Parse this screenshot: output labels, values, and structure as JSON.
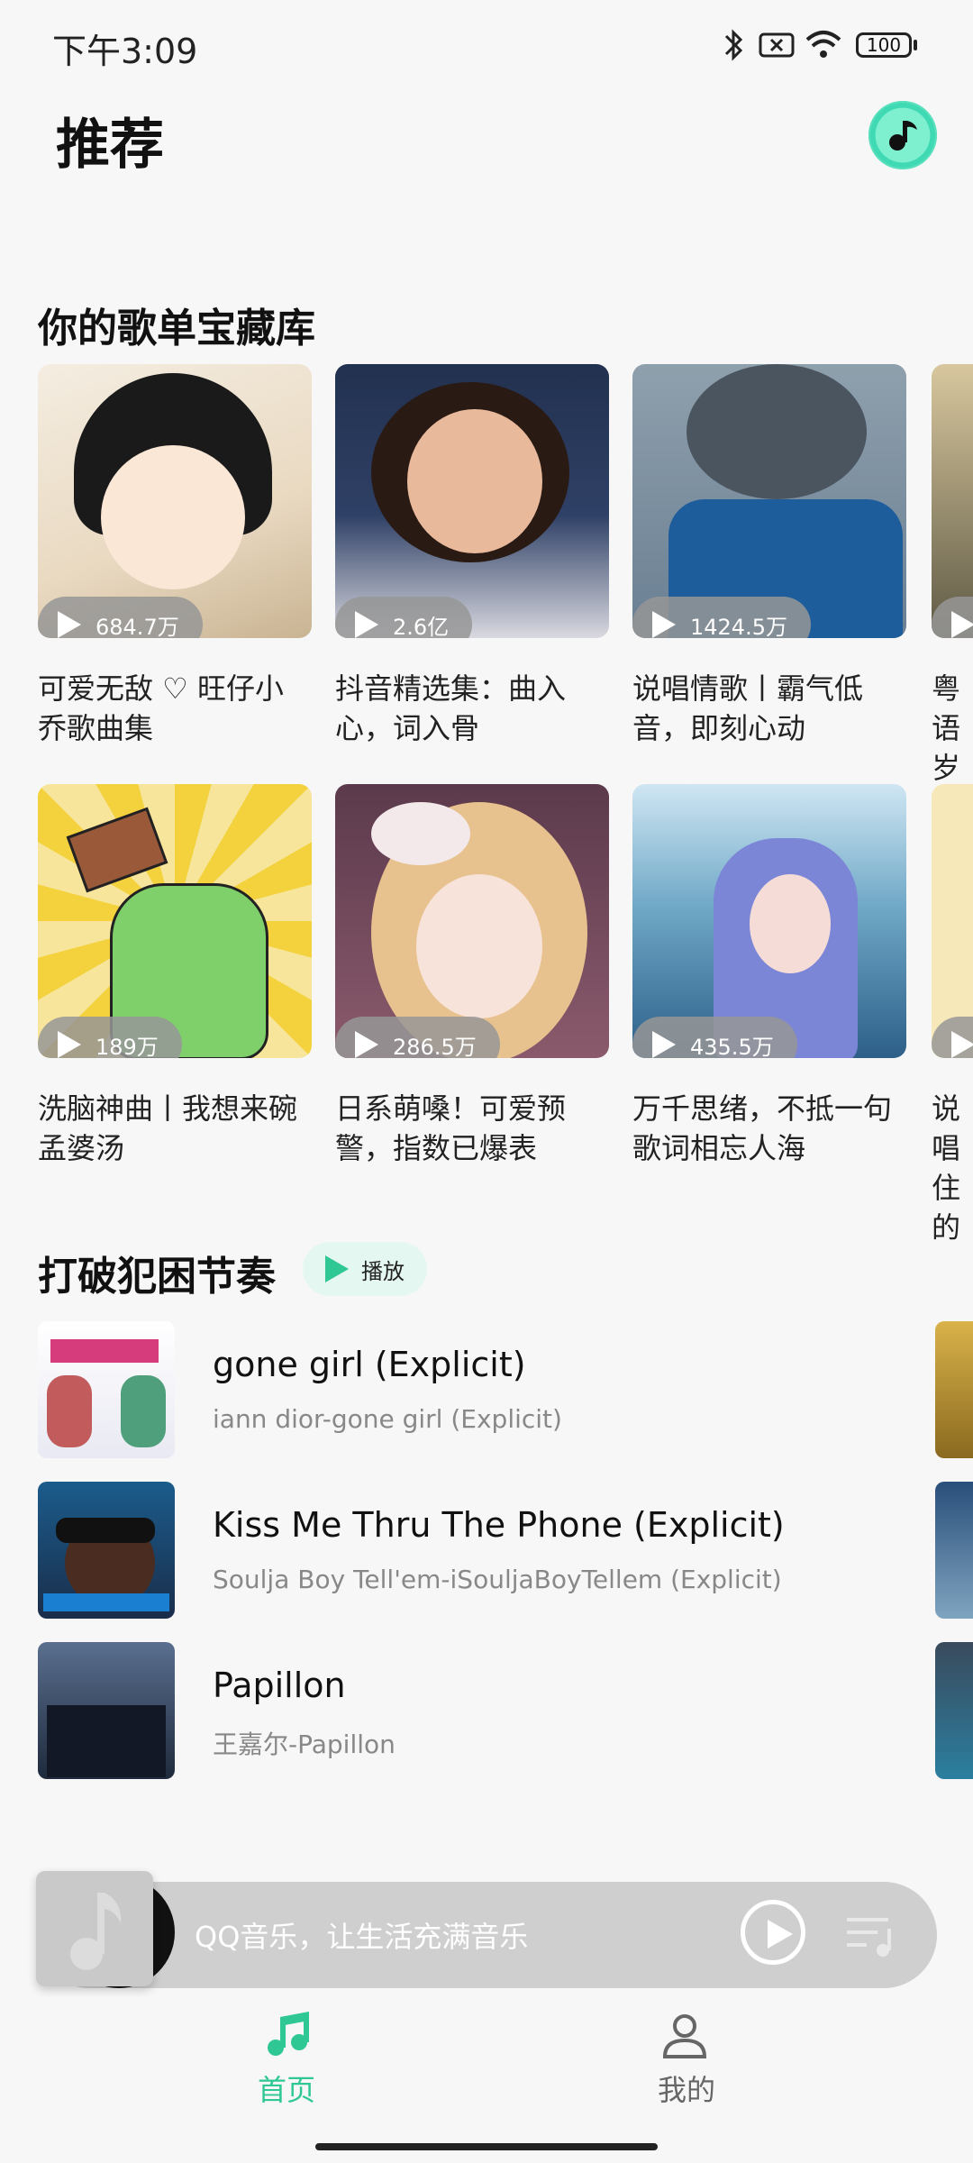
{
  "status_bar": {
    "time": "下午3:09",
    "battery": "100",
    "icons": [
      "bluetooth-icon",
      "sim-off-icon",
      "wifi-icon",
      "battery-icon"
    ]
  },
  "header": {
    "title": "推荐",
    "icon": "music-note-disc-icon"
  },
  "treasure_section": {
    "title": "你的歌单宝藏库",
    "playlists": [
      {
        "plays": "684.7万",
        "title": "可爱无敌 ♡ 旺仔小乔歌曲集"
      },
      {
        "plays": "2.6亿",
        "title": "抖音精选集：曲入心，词入骨"
      },
      {
        "plays": "1424.5万",
        "title": "说唱情歌丨霸气低音，即刻心动"
      },
      {
        "plays": "",
        "title": "粤语岁月"
      },
      {
        "plays": "189万",
        "title": "洗脑神曲丨我想来碗孟婆汤"
      },
      {
        "plays": "286.5万",
        "title": "日系萌嗓！可爱预警，指数已爆表"
      },
      {
        "plays": "435.5万",
        "title": "万千思绪，不抵一句歌词相忘人海"
      },
      {
        "plays": "",
        "title": "说唱住的"
      }
    ]
  },
  "rhythm_section": {
    "title": "打破犯困节奏",
    "play_label": "播放",
    "songs": [
      {
        "title": "gone girl (Explicit)",
        "subtitle": "iann dior-gone girl (Explicit)"
      },
      {
        "title": "Kiss Me Thru The Phone (Explicit)",
        "subtitle": "Soulja Boy Tell'em-iSouljaBoyTellem (Explicit)"
      },
      {
        "title": "Papillon",
        "subtitle": "王嘉尔-Papillon"
      }
    ]
  },
  "mini_player": {
    "text": "QQ音乐，让生活充满音乐"
  },
  "bottom_nav": {
    "items": [
      {
        "label": "首页",
        "icon": "music-note-icon",
        "active": true
      },
      {
        "label": "我的",
        "icon": "person-icon",
        "active": false
      }
    ],
    "active_color": "#2fc894",
    "inactive_color": "#666666"
  }
}
